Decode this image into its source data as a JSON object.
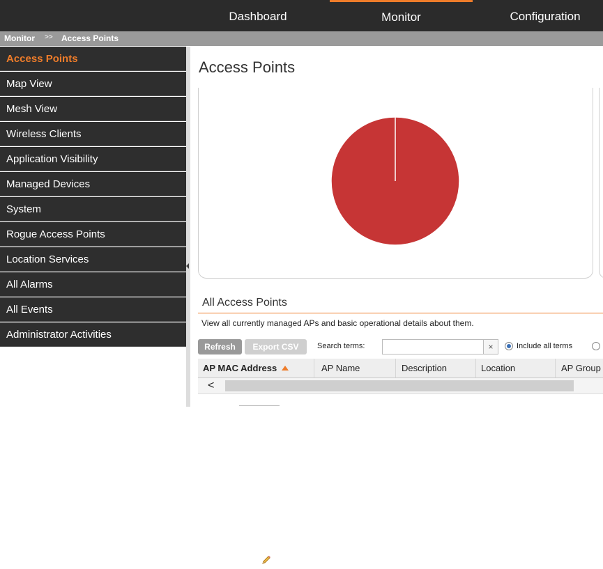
{
  "topnav": {
    "tabs": [
      {
        "label": "Dashboard"
      },
      {
        "label": "Monitor"
      },
      {
        "label": "Configuration"
      }
    ]
  },
  "breadcrumb": {
    "parent": "Monitor",
    "separator": ">>",
    "current": "Access Points"
  },
  "sidebar": {
    "items": [
      {
        "label": "Access Points"
      },
      {
        "label": "Map View"
      },
      {
        "label": "Mesh View"
      },
      {
        "label": "Wireless Clients"
      },
      {
        "label": "Application Visibility"
      },
      {
        "label": "Managed Devices"
      },
      {
        "label": "System"
      },
      {
        "label": "Rogue Access Points"
      },
      {
        "label": "Location Services"
      },
      {
        "label": "All Alarms"
      },
      {
        "label": "All Events"
      },
      {
        "label": "Administrator Activities"
      }
    ]
  },
  "main": {
    "title": "Access Points",
    "section_title": "All Access Points",
    "section_desc": "View all currently managed APs and basic operational details about them.",
    "buttons": {
      "refresh": "Refresh",
      "export": "Export CSV"
    },
    "search": {
      "label": "Search terms:",
      "value": "",
      "clear": "×",
      "include_all_terms": "Include all terms"
    },
    "table": {
      "columns": [
        {
          "label": "AP MAC Address"
        },
        {
          "label": "AP Name"
        },
        {
          "label": "Description"
        },
        {
          "label": "Location"
        },
        {
          "label": "AP Group"
        }
      ]
    },
    "scroll_left": "<"
  },
  "colors": {
    "accent": "#ee7c2a",
    "nav_bg": "#2b2b2b",
    "pie": "#c63535"
  },
  "chart_data": {
    "type": "pie",
    "values": [
      100
    ],
    "colors": [
      "#c63535"
    ]
  }
}
